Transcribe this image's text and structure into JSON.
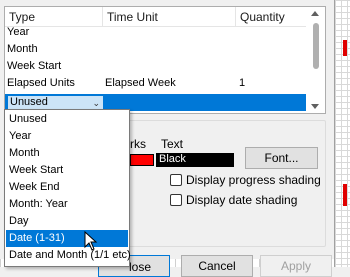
{
  "table": {
    "columns": [
      "Type",
      "Time Unit",
      "Quantity"
    ],
    "rows": [
      {
        "type": "Year",
        "unit": "",
        "qty": ""
      },
      {
        "type": "Month",
        "unit": "",
        "qty": ""
      },
      {
        "type": "Week Start",
        "unit": "",
        "qty": ""
      },
      {
        "type": "Elapsed Units",
        "unit": "Elapsed Week",
        "qty": "1"
      }
    ],
    "selected_value": "Unused"
  },
  "dropdown": {
    "items": [
      "Unused",
      "Year",
      "Month",
      "Week Start",
      "Week End",
      "Month: Year",
      "Day",
      "Date (1-31)",
      "Date and Month (1/1 etc)"
    ],
    "hovered": "Date (1-31)"
  },
  "colors": {
    "marks_label": "rks",
    "text_label": "Text",
    "marks_color": "#ff0000",
    "text_color_name": "Black"
  },
  "buttons": {
    "font": "Font...",
    "close": "lose",
    "cancel": "Cancel",
    "apply": "Apply"
  },
  "options": {
    "progress_shading": "Display progress shading",
    "date_shading": "Display date shading"
  }
}
